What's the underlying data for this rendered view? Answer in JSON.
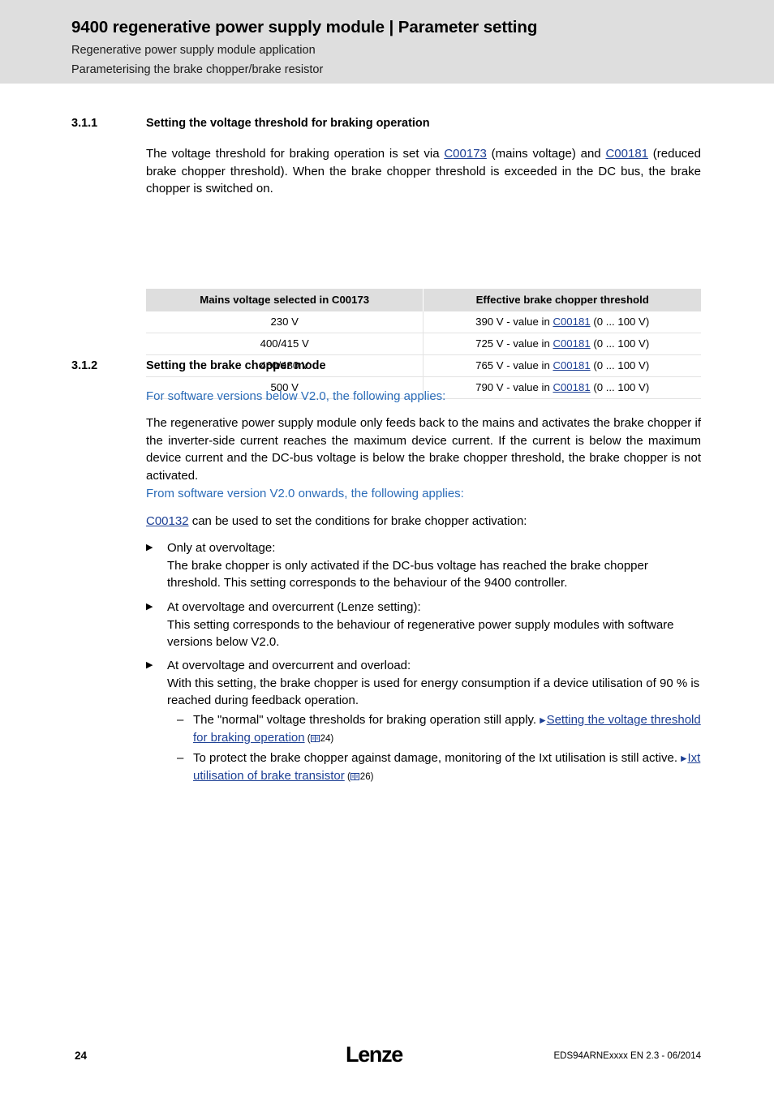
{
  "header": {
    "title": "9400 regenerative power supply module | Parameter setting",
    "subtitle1": "Regenerative power supply module application",
    "subtitle2": "Parameterising the brake chopper/brake resistor",
    "band_color": "#dedede"
  },
  "section_311": {
    "number": "3.1.1",
    "title": "Setting the voltage threshold for braking operation",
    "paragraph_part1": "The voltage threshold for braking operation is set via ",
    "link_c00173": "C00173",
    "paragraph_part2": " (mains voltage) and ",
    "link_c00181": "C00181",
    "paragraph_part3": " (reduced brake chopper threshold). When the brake chopper threshold is exceeded in the DC bus, the brake chopper is switched on."
  },
  "table": {
    "headers": [
      "Mains voltage selected in C00173",
      "Effective brake chopper threshold"
    ],
    "rows": [
      {
        "mains": "230 V",
        "prefix": "390 V - value in ",
        "link": "C00181",
        "suffix": " (0 ... 100 V)"
      },
      {
        "mains": "400/415 V",
        "prefix": "725 V - value in ",
        "link": "C00181",
        "suffix": " (0 ... 100 V)"
      },
      {
        "mains": "460/480 V",
        "prefix": "765 V - value in ",
        "link": "C00181",
        "suffix": " (0 ... 100 V)"
      },
      {
        "mains": "500 V",
        "prefix": "790 V - value in ",
        "link": "C00181",
        "suffix": " (0 ... 100 V)"
      }
    ]
  },
  "section_312": {
    "number": "3.1.2",
    "title": "Setting the brake chopper mode",
    "blue_heading_1": "For software versions below V2.0, the following applies:",
    "paragraph_1": "The regenerative power supply module only feeds back to the mains and activates the brake chopper if the inverter-side current reaches the maximum device current. If the current is below the maximum device current and the DC-bus voltage is below the brake chopper threshold, the brake chopper is not activated.",
    "blue_heading_2": "From software version V2.0 onwards, the following applies:",
    "intro_link": "C00132",
    "intro_text": " can be used to set the conditions for brake chopper activation:",
    "bullets": [
      {
        "title": "Only at overvoltage:",
        "text": "The brake chopper is only activated if the DC-bus voltage has reached the brake chopper threshold. This setting corresponds to the behaviour of the 9400 controller."
      },
      {
        "title": "At overvoltage and overcurrent (Lenze setting):",
        "text": "This setting corresponds to the behaviour of regenerative power supply modules with software versions below V2.0."
      },
      {
        "title": "At overvoltage and overcurrent and overload:",
        "text": "With this setting, the brake chopper is used for energy consumption if a device utilisation of 90 % is reached during feedback operation."
      }
    ],
    "subitems": [
      {
        "text": "The \"normal\" voltage thresholds for braking operation still apply.",
        "xref_label": "Setting the voltage threshold for braking operation",
        "xref_page": "24"
      },
      {
        "text": "To protect the brake chopper against damage, monitoring of the Ixt utilisation is still active.",
        "xref_label": "Ixt utilisation of brake transistor",
        "xref_page": "26"
      }
    ]
  },
  "footer": {
    "page_number": "24",
    "logo": "Lenze",
    "document_id": "EDS94ARNExxxx EN 2.3 - 06/2014"
  },
  "colors": {
    "link": "#1c3f94",
    "blue_heading": "#2b6cb8",
    "header_band": "#dedede",
    "table_header": "#dedede",
    "row_rule": "#e3e3e3"
  }
}
